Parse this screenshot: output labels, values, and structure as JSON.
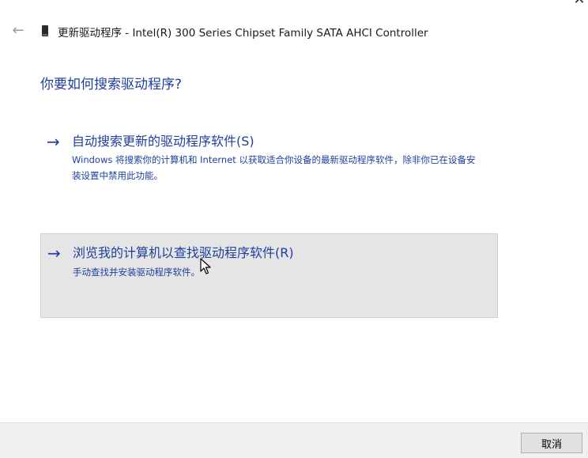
{
  "window": {
    "title": "更新驱动程序 - Intel(R) 300 Series Chipset Family SATA AHCI Controller",
    "close_glyph": "✕",
    "back_glyph": "←"
  },
  "heading": "你要如何搜索驱动程序?",
  "options": [
    {
      "arrow": "→",
      "title": "自动搜索更新的驱动程序软件(S)",
      "description": "Windows 将搜索你的计算机和 Internet 以获取适合你设备的最新驱动程序软件，除非你已在设备安装设置中禁用此功能。"
    },
    {
      "arrow": "→",
      "title": "浏览我的计算机以查找驱动程序软件(R)",
      "description": "手动查找并安装驱动程序软件。"
    }
  ],
  "footer": {
    "cancel_label": "取消"
  },
  "colors": {
    "link_blue": "#1f3f9f",
    "hover_background": "#e5e5e5",
    "footer_background": "#f0f0f0"
  }
}
